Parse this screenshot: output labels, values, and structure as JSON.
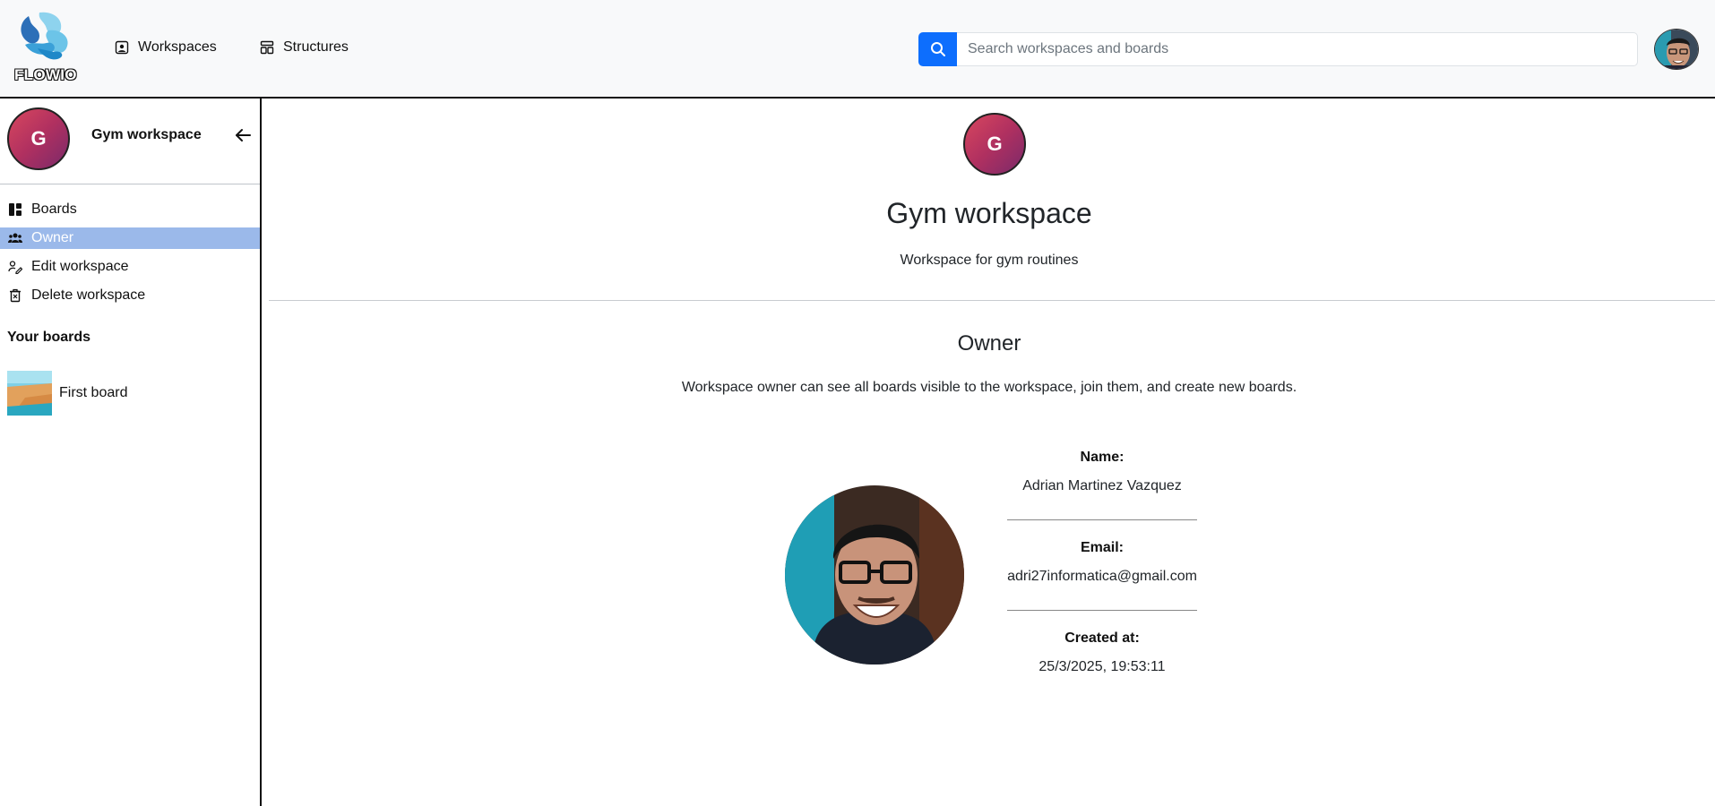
{
  "header": {
    "logo_text": "FLOWIO",
    "nav": [
      {
        "label": "Workspaces",
        "icon": "workspace-icon"
      },
      {
        "label": "Structures",
        "icon": "structure-icon"
      }
    ],
    "search": {
      "placeholder": "Search workspaces and boards",
      "value": ""
    },
    "accent_color": "#0d6efd"
  },
  "sidebar": {
    "workspace_initial": "G",
    "workspace_name": "Gym workspace",
    "items": [
      {
        "label": "Boards",
        "icon": "boards-icon",
        "active": false
      },
      {
        "label": "Owner",
        "icon": "users-icon",
        "active": true
      },
      {
        "label": "Edit workspace",
        "icon": "edit-icon",
        "active": false
      },
      {
        "label": "Delete workspace",
        "icon": "trash-icon",
        "active": false
      }
    ],
    "your_boards_title": "Your boards",
    "boards": [
      {
        "label": "First board"
      }
    ],
    "active_color": "#9bb9ea"
  },
  "main": {
    "workspace_initial": "G",
    "workspace_title": "Gym workspace",
    "workspace_description": "Workspace for gym routines",
    "owner_title": "Owner",
    "owner_description": "Workspace owner can see all boards visible to the workspace, join them, and create new boards.",
    "owner": {
      "name_label": "Name:",
      "name": "Adrian Martinez Vazquez",
      "email_label": "Email:",
      "email": "adri27informatica@gmail.com",
      "created_label": "Created at:",
      "created": "25/3/2025, 19:53:11"
    }
  }
}
